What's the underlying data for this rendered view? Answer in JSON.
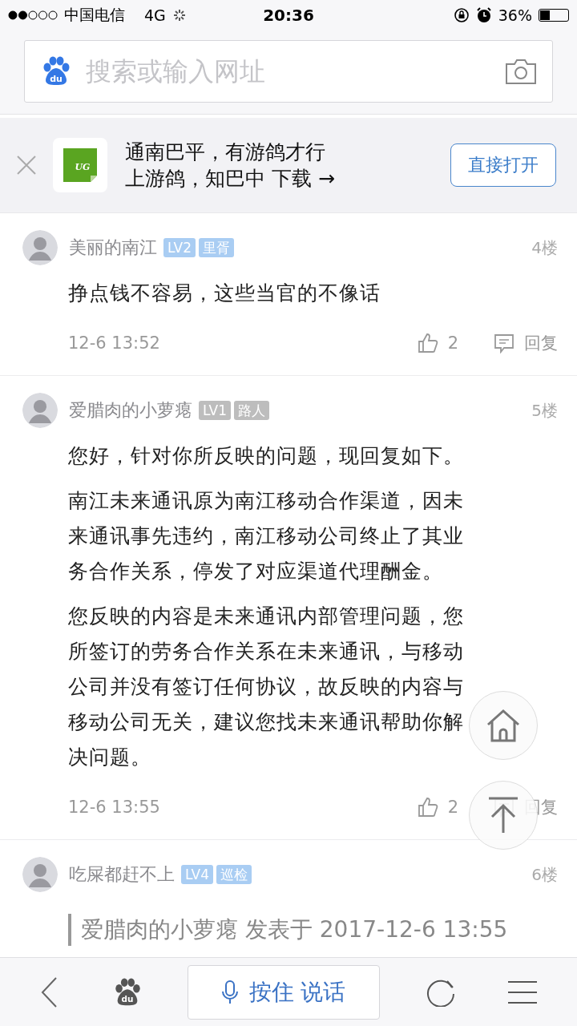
{
  "status_bar": {
    "carrier": "中国电信",
    "network": "4G",
    "time": "20:36",
    "battery": "36%"
  },
  "search": {
    "placeholder": "搜索或输入网址",
    "logo_text": "du"
  },
  "app_banner": {
    "lines": [
      "通南巴平，有游鸽才行",
      "上游鸽，知巴中 下载 →"
    ],
    "button": "直接打开",
    "app_logo_text": "UG"
  },
  "posts": [
    {
      "author": "美丽的南江",
      "badges": [
        {
          "text": "LV2",
          "color": "#a9cdf3"
        },
        {
          "text": "里胥",
          "color": "#a9cdf3"
        }
      ],
      "floor": "4楼",
      "paragraphs": [
        "挣点钱不容易，这些当官的不像话"
      ],
      "time": "12-6 13:52",
      "likes": "2",
      "reply": "回复"
    },
    {
      "author": "爱腊肉的小萝瘪",
      "badges": [
        {
          "text": "LV1",
          "color": "#bdbdbd"
        },
        {
          "text": "路人",
          "color": "#bdbdbd"
        }
      ],
      "floor": "5楼",
      "paragraphs": [
        "您好，针对你所反映的问题，现回复如下。",
        "南江未来通讯原为南江移动合作渠道，因未来通讯事先违约，南江移动公司终止了其业务合作关系，停发了对应渠道代理酬金。",
        "您反映的内容是未来通讯内部管理问题，您所签订的劳务合作关系在未来通讯，与移动公司并没有签订任何协议，故反映的内容与移动公司无关，建议您找未来通讯帮助你解决问题。"
      ],
      "time": "12-6 13:55",
      "likes": "2",
      "reply": "回复"
    },
    {
      "author": "吃屎都赶不上",
      "badges": [
        {
          "text": "LV4",
          "color": "#a9cdf3"
        },
        {
          "text": "巡检",
          "color": "#a9cdf3"
        }
      ],
      "floor": "6楼",
      "quote": "爱腊肉的小萝瘪 发表于 2017-12-6 13:55"
    }
  ],
  "bottom_bar": {
    "voice_button": "按住 说话",
    "logo_text": "du"
  }
}
